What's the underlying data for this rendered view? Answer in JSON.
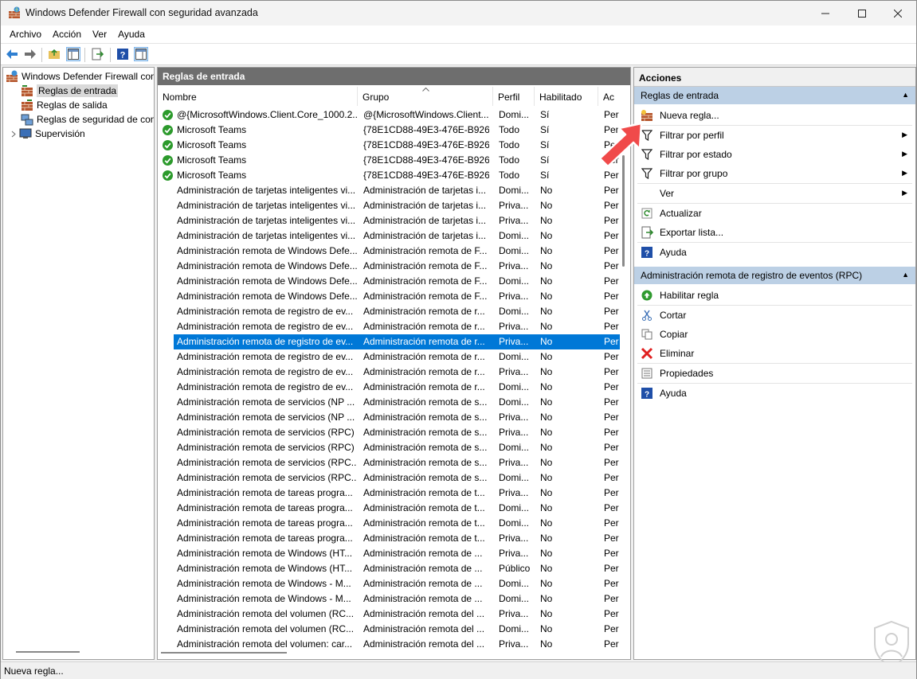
{
  "window": {
    "title": "Windows Defender Firewall con seguridad avanzada"
  },
  "menu": [
    "Archivo",
    "Acción",
    "Ver",
    "Ayuda"
  ],
  "tree": {
    "root": "Windows Defender Firewall con",
    "items": [
      "Reglas de entrada",
      "Reglas de salida",
      "Reglas de seguridad de con",
      "Supervisión"
    ]
  },
  "center": {
    "header": "Reglas de entrada",
    "columns": [
      "Nombre",
      "Grupo",
      "Perfil",
      "Habilitado",
      "Ac"
    ],
    "rows": [
      {
        "name": "@{MicrosoftWindows.Client.Core_1000.2...",
        "group": "@{MicrosoftWindows.Client...",
        "profile": "Domi...",
        "enabled": "Sí",
        "action": "Per",
        "check": true
      },
      {
        "name": "Microsoft Teams",
        "group": "{78E1CD88-49E3-476E-B926-...",
        "profile": "Todo",
        "enabled": "Sí",
        "action": "Per",
        "check": true
      },
      {
        "name": "Microsoft Teams",
        "group": "{78E1CD88-49E3-476E-B926-...",
        "profile": "Todo",
        "enabled": "Sí",
        "action": "Per",
        "check": true
      },
      {
        "name": "Microsoft Teams",
        "group": "{78E1CD88-49E3-476E-B926-...",
        "profile": "Todo",
        "enabled": "Sí",
        "action": "Per",
        "check": true
      },
      {
        "name": "Microsoft Teams",
        "group": "{78E1CD88-49E3-476E-B926-...",
        "profile": "Todo",
        "enabled": "Sí",
        "action": "Per",
        "check": true
      },
      {
        "name": "Administración de tarjetas inteligentes vi...",
        "group": "Administración de tarjetas i...",
        "profile": "Domi...",
        "enabled": "No",
        "action": "Per"
      },
      {
        "name": "Administración de tarjetas inteligentes vi...",
        "group": "Administración de tarjetas i...",
        "profile": "Priva...",
        "enabled": "No",
        "action": "Per"
      },
      {
        "name": "Administración de tarjetas inteligentes vi...",
        "group": "Administración de tarjetas i...",
        "profile": "Priva...",
        "enabled": "No",
        "action": "Per"
      },
      {
        "name": "Administración de tarjetas inteligentes vi...",
        "group": "Administración de tarjetas i...",
        "profile": "Domi...",
        "enabled": "No",
        "action": "Per"
      },
      {
        "name": "Administración remota de Windows Defe...",
        "group": "Administración remota de F...",
        "profile": "Domi...",
        "enabled": "No",
        "action": "Per"
      },
      {
        "name": "Administración remota de Windows Defe...",
        "group": "Administración remota de F...",
        "profile": "Priva...",
        "enabled": "No",
        "action": "Per"
      },
      {
        "name": "Administración remota de Windows Defe...",
        "group": "Administración remota de F...",
        "profile": "Domi...",
        "enabled": "No",
        "action": "Per"
      },
      {
        "name": "Administración remota de Windows Defe...",
        "group": "Administración remota de F...",
        "profile": "Priva...",
        "enabled": "No",
        "action": "Per"
      },
      {
        "name": "Administración remota de registro de ev...",
        "group": "Administración remota de r...",
        "profile": "Domi...",
        "enabled": "No",
        "action": "Per"
      },
      {
        "name": "Administración remota de registro de ev...",
        "group": "Administración remota de r...",
        "profile": "Priva...",
        "enabled": "No",
        "action": "Per"
      },
      {
        "name": "Administración remota de registro de ev...",
        "group": "Administración remota de r...",
        "profile": "Priva...",
        "enabled": "No",
        "action": "Per",
        "selected": true
      },
      {
        "name": "Administración remota de registro de ev...",
        "group": "Administración remota de r...",
        "profile": "Domi...",
        "enabled": "No",
        "action": "Per"
      },
      {
        "name": "Administración remota de registro de ev...",
        "group": "Administración remota de r...",
        "profile": "Priva...",
        "enabled": "No",
        "action": "Per"
      },
      {
        "name": "Administración remota de registro de ev...",
        "group": "Administración remota de r...",
        "profile": "Domi...",
        "enabled": "No",
        "action": "Per"
      },
      {
        "name": "Administración remota de servicios (NP ...",
        "group": "Administración remota de s...",
        "profile": "Domi...",
        "enabled": "No",
        "action": "Per"
      },
      {
        "name": "Administración remota de servicios (NP ...",
        "group": "Administración remota de s...",
        "profile": "Priva...",
        "enabled": "No",
        "action": "Per"
      },
      {
        "name": "Administración remota de servicios (RPC)",
        "group": "Administración remota de s...",
        "profile": "Priva...",
        "enabled": "No",
        "action": "Per"
      },
      {
        "name": "Administración remota de servicios (RPC)",
        "group": "Administración remota de s...",
        "profile": "Domi...",
        "enabled": "No",
        "action": "Per"
      },
      {
        "name": "Administración remota de servicios (RPC...",
        "group": "Administración remota de s...",
        "profile": "Priva...",
        "enabled": "No",
        "action": "Per"
      },
      {
        "name": "Administración remota de servicios (RPC...",
        "group": "Administración remota de s...",
        "profile": "Domi...",
        "enabled": "No",
        "action": "Per"
      },
      {
        "name": "Administración remota de tareas progra...",
        "group": "Administración remota de t...",
        "profile": "Priva...",
        "enabled": "No",
        "action": "Per"
      },
      {
        "name": "Administración remota de tareas progra...",
        "group": "Administración remota de t...",
        "profile": "Domi...",
        "enabled": "No",
        "action": "Per"
      },
      {
        "name": "Administración remota de tareas progra...",
        "group": "Administración remota de t...",
        "profile": "Domi...",
        "enabled": "No",
        "action": "Per"
      },
      {
        "name": "Administración remota de tareas progra...",
        "group": "Administración remota de t...",
        "profile": "Priva...",
        "enabled": "No",
        "action": "Per"
      },
      {
        "name": "Administración remota de Windows (HT...",
        "group": "Administración remota de ...",
        "profile": "Priva...",
        "enabled": "No",
        "action": "Per"
      },
      {
        "name": "Administración remota de Windows (HT...",
        "group": "Administración remota de ...",
        "profile": "Público",
        "enabled": "No",
        "action": "Per"
      },
      {
        "name": "Administración remota de Windows - M...",
        "group": "Administración remota de ...",
        "profile": "Domi...",
        "enabled": "No",
        "action": "Per"
      },
      {
        "name": "Administración remota de Windows - M...",
        "group": "Administración remota de ...",
        "profile": "Domi...",
        "enabled": "No",
        "action": "Per"
      },
      {
        "name": "Administración remota del volumen (RC...",
        "group": "Administración remota del ...",
        "profile": "Priva...",
        "enabled": "No",
        "action": "Per"
      },
      {
        "name": "Administración remota del volumen (RC...",
        "group": "Administración remota del ...",
        "profile": "Domi...",
        "enabled": "No",
        "action": "Per"
      },
      {
        "name": "Administración remota del volumen: car...",
        "group": "Administración remota del ...",
        "profile": "Priva...",
        "enabled": "No",
        "action": "Per"
      }
    ]
  },
  "actions": {
    "header": "Acciones",
    "section1": {
      "title": "Reglas de entrada",
      "items": [
        {
          "label": "Nueva regla...",
          "icon": "new-rule-icon"
        },
        {
          "label": "Filtrar por perfil",
          "icon": "filter-icon",
          "submenu": true
        },
        {
          "label": "Filtrar por estado",
          "icon": "filter-icon",
          "submenu": true
        },
        {
          "label": "Filtrar por grupo",
          "icon": "filter-icon",
          "submenu": true
        },
        {
          "label": "Ver",
          "icon": "",
          "submenu": true
        },
        {
          "label": "Actualizar",
          "icon": "refresh-icon"
        },
        {
          "label": "Exportar lista...",
          "icon": "export-icon"
        },
        {
          "label": "Ayuda",
          "icon": "help-icon"
        }
      ]
    },
    "section2": {
      "title": "Administración remota de registro de eventos (RPC)",
      "items": [
        {
          "label": "Habilitar regla",
          "icon": "enable-icon"
        },
        {
          "label": "Cortar",
          "icon": "cut-icon"
        },
        {
          "label": "Copiar",
          "icon": "copy-icon"
        },
        {
          "label": "Eliminar",
          "icon": "delete-icon"
        },
        {
          "label": "Propiedades",
          "icon": "properties-icon"
        },
        {
          "label": "Ayuda",
          "icon": "help-icon"
        }
      ]
    }
  },
  "statusbar": {
    "text": "Nueva regla..."
  },
  "colors": {
    "selection": "#0078d7",
    "section_bg": "#bcd0e5",
    "center_header_bg": "#6e6e6e"
  }
}
